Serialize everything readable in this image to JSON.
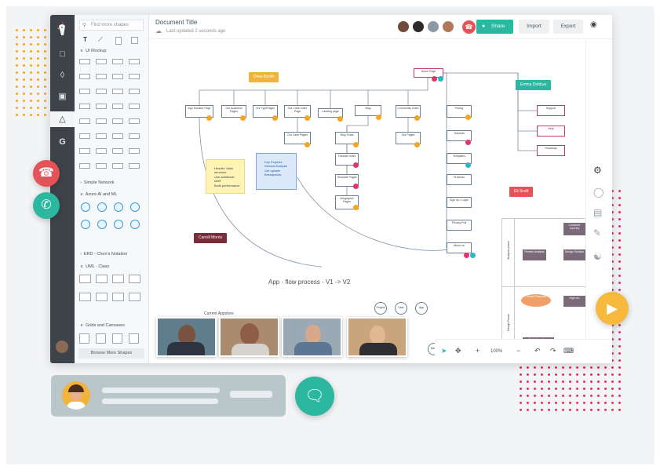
{
  "document": {
    "title": "Document Title",
    "last_updated": "Last updated 2 seconds ago"
  },
  "toolbar": {
    "share_label": "Share",
    "import_label": "Import",
    "export_label": "Export"
  },
  "shape_library": {
    "search_placeholder": "Find more shapes",
    "sections": [
      "UI Mockup",
      "Simple Network",
      "Azure AI and ML",
      "ERD - Chen's Notation",
      "UML - Class",
      "Grids and Canvases"
    ],
    "browse_label": "Browse More Shapes"
  },
  "canvas": {
    "title": "App - flow process - V1 -> V2",
    "subtitle": "Current Appstore",
    "cursor_tags": [
      {
        "name": "Drew Booth",
        "color": "#f2b33d"
      },
      {
        "name": "Emma Dobbus",
        "color": "#2bb7a0"
      },
      {
        "name": "Eli Scott",
        "color": "#e55257"
      },
      {
        "name": "Carroll Morris",
        "color": "#7a2c3a"
      }
    ],
    "nodes": {
      "home": "Home Page",
      "app_solution": "App Solution Page",
      "our_business": "Our Business Pages",
      "our_type": "Our TypePages",
      "our_case_index": "Our Case Index Page",
      "landing": "Landing page",
      "blog": "Blog",
      "community": "Community Index",
      "our_case_pages": "Our Case Pages",
      "blog_posts": "Blog Posts",
      "tutorials_index": "Tutorials Index",
      "template_pages": "Template Pages",
      "infographic_pages": "Infographic Pages",
      "our_pages": "Our Pages",
      "pricing": "Pricing",
      "tutorials": "Tutorials",
      "templates": "Templates",
      "products": "Products",
      "signup": "Sign Up / Login",
      "privacy": "Privacy Poli",
      "about_us": "About us",
      "support": "Support",
      "help": "Help",
      "roadmap": "Roadmap",
      "project": "Project",
      "user": "User",
      "app": "App",
      "base": "Base"
    },
    "notes": [
      [
        "Header: Main",
        "structure",
        "Use additional shelf",
        "Build performance"
      ],
      [
        "Key Projects",
        "Internal Analysis",
        "Get update",
        "Breadpoints"
      ]
    ],
    "swimlane_labels": [
      "Analysis phase",
      "Design Phase"
    ],
    "swimlane_boxes": [
      "Customer Journey",
      "Review Analysis",
      "Design Solution",
      "Create Proposal",
      "High rev",
      "Build & confirm Improvement feedback"
    ]
  },
  "zoom": {
    "level": "100%"
  },
  "colors": {
    "accent": "#2bb7a0",
    "end_call": "#e55257",
    "video": "#f6b93b",
    "rail": "#3e434a",
    "orange": "#f4a623",
    "pink": "#e5326a",
    "teal": "#2bb7c4"
  },
  "call": {
    "end_icon": "phone-hangup-icon",
    "accept_icon": "phone-icon",
    "video_icon": "video-camera-icon",
    "chat_icon": "chat-bubble-icon"
  }
}
